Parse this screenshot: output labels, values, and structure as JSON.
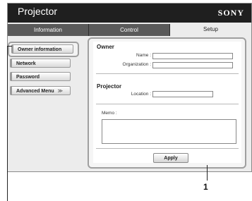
{
  "header": {
    "title": "Projector",
    "brand": "SONY"
  },
  "tabs": [
    {
      "label": "Information"
    },
    {
      "label": "Control"
    },
    {
      "label": "Setup"
    }
  ],
  "sidebar": {
    "items": [
      {
        "label": "Owner information"
      },
      {
        "label": "Network"
      },
      {
        "label": "Password"
      },
      {
        "label": "Advanced Menu",
        "icon": "double-chevron-down-icon"
      }
    ]
  },
  "owner": {
    "title": "Owner",
    "name_label": "Name :",
    "org_label": "Organization :"
  },
  "projector": {
    "title": "Projector",
    "location_label": "Location :"
  },
  "memo": {
    "label": "Memo :"
  },
  "apply": {
    "label": "Apply"
  },
  "callout": {
    "number": "1"
  }
}
